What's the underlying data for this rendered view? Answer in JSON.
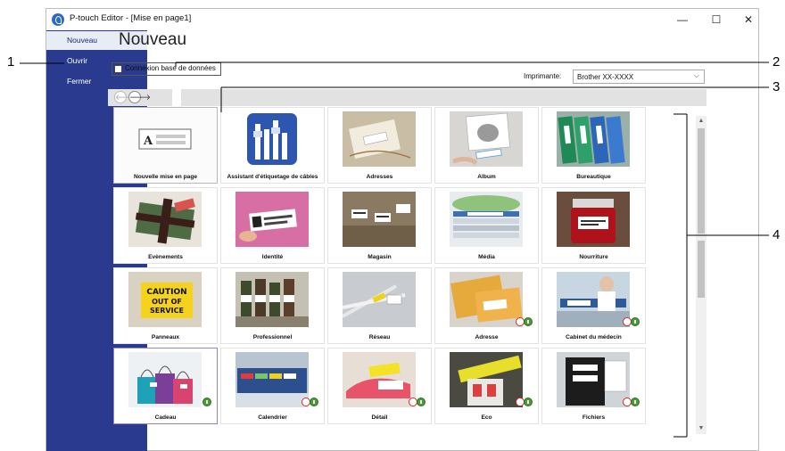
{
  "window": {
    "title": "P-touch Editor - [Mise en page1]",
    "minimize": "—",
    "maximize": "☐",
    "close": "✕"
  },
  "sidebar": {
    "items": [
      {
        "label": "Nouveau",
        "active": true
      },
      {
        "label": "Ouvrir",
        "active": false
      },
      {
        "label": "Fermer",
        "active": false
      }
    ]
  },
  "main": {
    "title": "Nouveau",
    "db_checkbox_label": "Connexion base de données",
    "db_checked": false,
    "printer_label": "Imprimante:",
    "printer_value": "Brother XX-XXXX"
  },
  "nav": {
    "back": "🡐",
    "forward": "🡒"
  },
  "tiles": [
    {
      "label": "Nouvelle mise en page"
    },
    {
      "label": "Assistant d'étiquetage de câbles"
    },
    {
      "label": "Adresses"
    },
    {
      "label": "Album"
    },
    {
      "label": "Bureautique"
    },
    {
      "label": "Evènements"
    },
    {
      "label": "Identité"
    },
    {
      "label": "Magasin"
    },
    {
      "label": "Média"
    },
    {
      "label": "Nourriture"
    },
    {
      "label": "Panneaux"
    },
    {
      "label": "Professionnel"
    },
    {
      "label": "Réseau"
    },
    {
      "label": "Adresse"
    },
    {
      "label": "Cabinet du médecin"
    },
    {
      "label": "Cadeau"
    },
    {
      "label": "Calendrier"
    },
    {
      "label": "Détail"
    },
    {
      "label": "Eco"
    },
    {
      "label": "Fichiers"
    }
  ],
  "thumb_text": {
    "caution_1": "CAUTION",
    "caution_2": "OUT OF",
    "caution_3": "SERVICE"
  },
  "callouts": [
    "1",
    "2",
    "3",
    "4"
  ],
  "colors": {
    "sidebar": "#2a3b8f",
    "sidebar_active": "#e8ecf5",
    "download_badge": "#4a9c3a",
    "forbidden_badge": "#c9302c"
  }
}
